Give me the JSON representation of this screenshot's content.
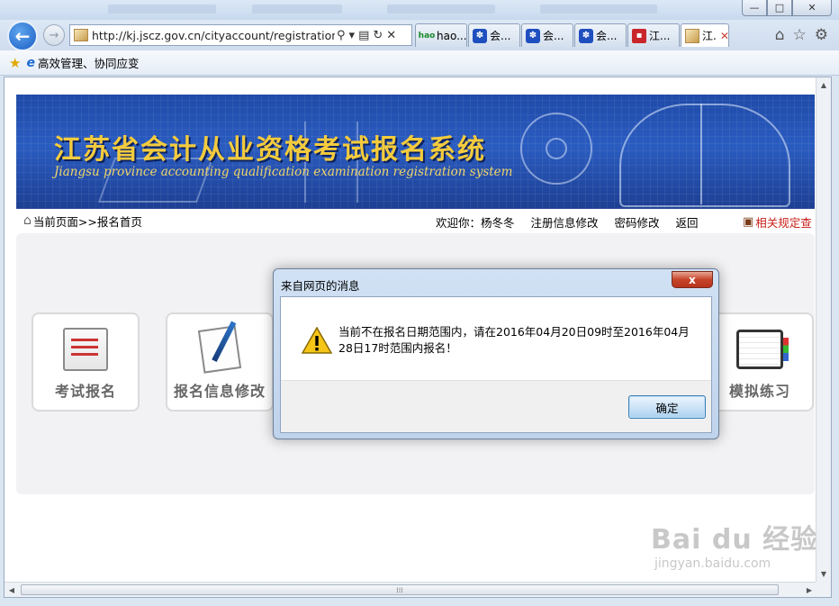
{
  "browser": {
    "address_url": "http://kj.jscz.gov.cn/cityaccount/registration.jsp",
    "tabs": [
      {
        "label": "hao...",
        "icon": "hao123-icon"
      },
      {
        "label": "会...",
        "icon": "baidu-paw-icon"
      },
      {
        "label": "会...",
        "icon": "baidu-paw-icon"
      },
      {
        "label": "会...",
        "icon": "baidu-paw-icon"
      },
      {
        "label": "江...",
        "icon": "red-site-icon"
      },
      {
        "label": "江.",
        "icon": "page-icon",
        "active": true
      }
    ],
    "tab_close_glyph": "✕",
    "window_buttons": {
      "minimize": "—",
      "maximize": "□",
      "close": "✕"
    },
    "favorites": {
      "item_label": "高效管理、协同应变"
    },
    "scroll_thumb_glyph": "⁞⁞⁞"
  },
  "page": {
    "banner_title": "江苏省会计从业资格考试报名系统",
    "banner_subtitle": "Jiangsu province accounting qualification examination registration system",
    "breadcrumb": "当前页面>>报名首页",
    "welcome": "欢迎你：杨冬冬",
    "nav_links": [
      "注册信息修改",
      "密码修改",
      "返回"
    ],
    "rules_link": "相关规定查",
    "tiles": [
      {
        "label": "考试报名",
        "icon": "exam-form-icon"
      },
      {
        "label": "报名信息修改",
        "icon": "pen-paper-icon"
      },
      {
        "label": "模拟练习",
        "icon": "notebook-icon"
      }
    ]
  },
  "dialog": {
    "title": "来自网页的消息",
    "close_glyph": "x",
    "message": "当前不在报名日期范围内，请在2016年04月20日09时至2016年04月28日17时范围内报名！",
    "ok_label": "确定"
  },
  "watermark": {
    "main": "Bai du 经验",
    "sub": "jingyan.baidu.com"
  },
  "colors": {
    "accent": "#1f4aa8",
    "banner_text": "#f4cb3d",
    "rules_link": "#c8201a"
  }
}
